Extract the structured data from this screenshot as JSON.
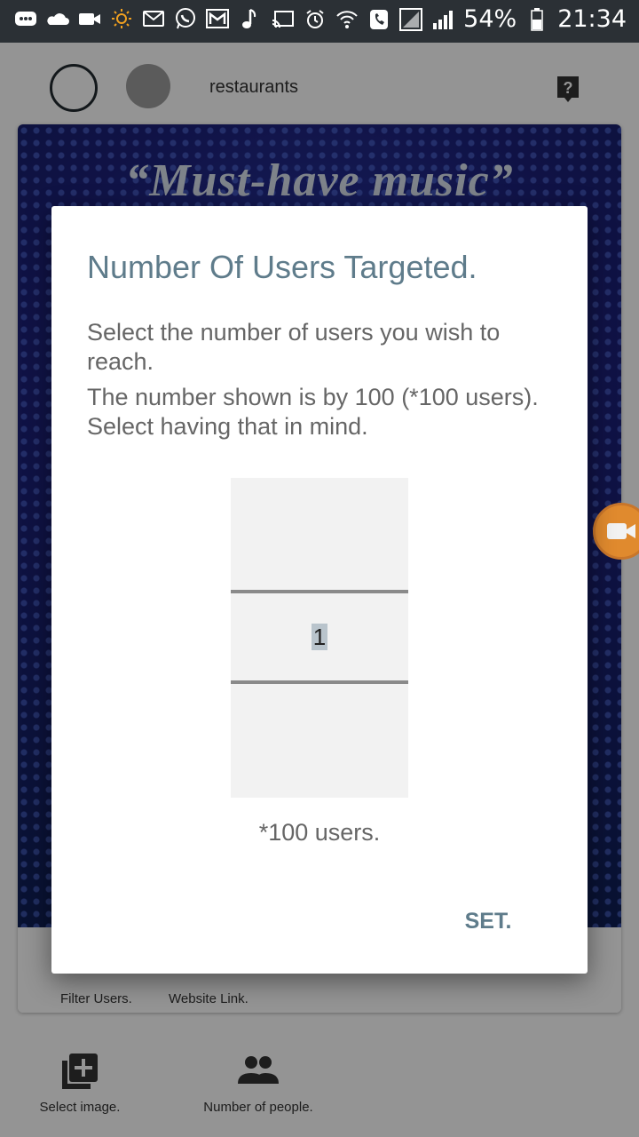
{
  "status_bar": {
    "battery": "54%",
    "time": "21:34",
    "icons": [
      "message-icon",
      "cloud-icon",
      "video-icon",
      "brightness-icon",
      "gmail-icon",
      "whatsapp-icon",
      "mail-icon",
      "music-icon",
      "cast-icon",
      "alarm-icon",
      "wifi-call-icon",
      "phone-icon",
      "signal-box-icon",
      "signal-icon",
      "battery-icon"
    ]
  },
  "header": {
    "title": "restaurants"
  },
  "banner": {
    "text": "“Must-have music”"
  },
  "card_actions": {
    "filter_label": "Filter Users.",
    "website_label": "Website Link."
  },
  "bottom_actions": {
    "select_image_label": "Select image.",
    "number_people_label": "Number of people."
  },
  "dialog": {
    "title": "Number Of Users Targeted.",
    "message_1": "Select the number of users you wish to reach.",
    "message_2": "The number shown is by 100 (*100 users). Select having that in mind.",
    "picker_value": "1",
    "unit_label": "*100 users.",
    "set_label": "SET."
  },
  "colors": {
    "accent": "#5f7c8b",
    "status_bar": "#2b3035",
    "float_badge": "#e08a2e"
  }
}
